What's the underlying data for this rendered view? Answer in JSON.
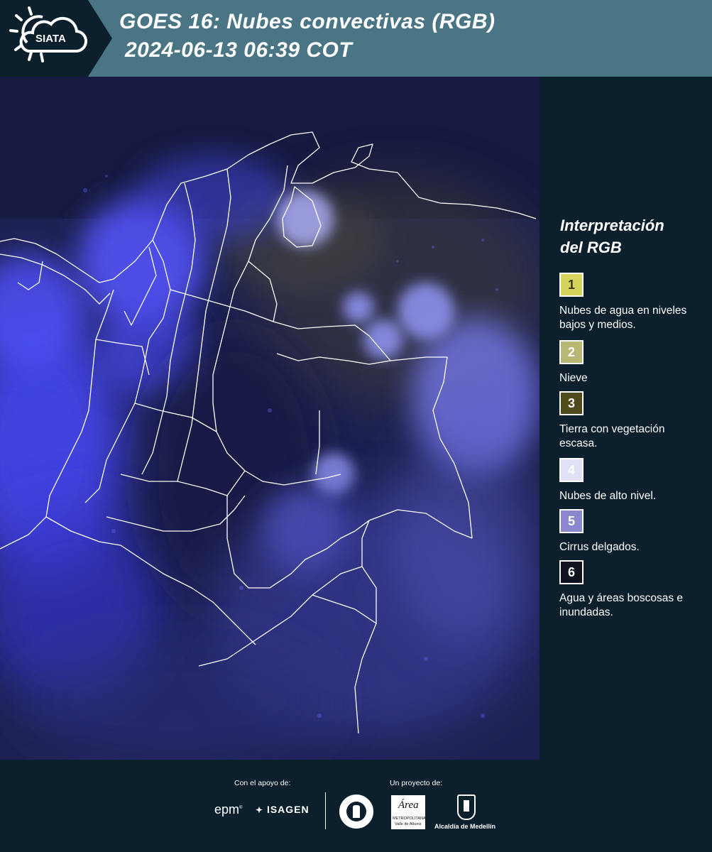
{
  "header": {
    "logo_text": "SIATA",
    "title_line1": "GOES 16: Nubes convectivas (RGB)",
    "title_line2": "2024-06-13 06:39 COT"
  },
  "legend": {
    "title_line1": "Interpretación",
    "title_line2": "del RGB",
    "items": [
      {
        "num": "1",
        "label": "Nubes de agua en niveles bajos y medios.",
        "color": "#d6d45c",
        "text_color": "#3a3a1a"
      },
      {
        "num": "2",
        "label": "Nieve",
        "color": "#b8b876",
        "text_color": "#ffffff"
      },
      {
        "num": "3",
        "label": "Tierra con vegetación escasa.",
        "color": "#4e4a1c",
        "text_color": "#ffffff"
      },
      {
        "num": "4",
        "label": "Nubes de alto nivel.",
        "color": "#e0e0f6",
        "text_color": "#ffffff"
      },
      {
        "num": "5",
        "label": "Cirrus delgados.",
        "color": "#8a88cc",
        "text_color": "#ffffff"
      },
      {
        "num": "6",
        "label": "Agua y áreas boscosas e inundadas.",
        "color": "#11121f",
        "text_color": "#ffffff"
      }
    ]
  },
  "footer": {
    "support_label": "Con el apoyo de:",
    "project_label": "Un proyecto de:",
    "sponsor_epm": "epm",
    "sponsor_isagen": "ISAGEN",
    "sponsor_area": "Área",
    "sponsor_area_sub": "METROPOLITANA",
    "sponsor_area_sub2": "Valle de Aburrá",
    "sponsor_alcaldia": "Alcaldía de Medellín"
  },
  "colors": {
    "header_bg": "#4a7585",
    "panel_bg": "#0b1f2d",
    "map_base": "#1c2150",
    "cloud_blue": "#4b4cf2",
    "border_line": "#ffffff"
  }
}
